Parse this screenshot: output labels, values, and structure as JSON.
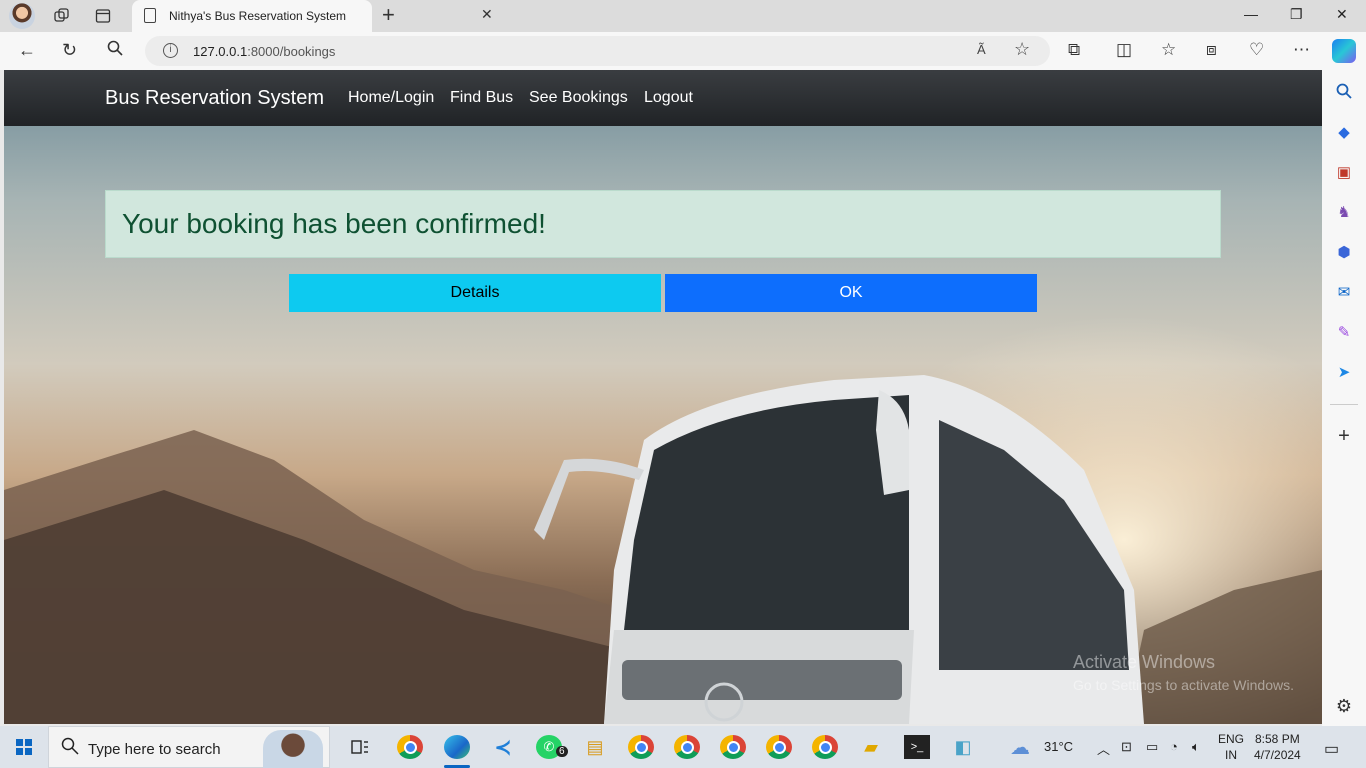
{
  "browser": {
    "tab_title": "Nithya's Bus Reservation System",
    "url_host": "127.0.0.1",
    "url_path": ":8000/bookings",
    "read_aloud": "Ã"
  },
  "page": {
    "brand": "Bus Reservation System",
    "nav_links": [
      "Home/Login",
      "Find Bus",
      "See Bookings",
      "Logout"
    ],
    "alert_message": "Your booking has been confirmed!",
    "details_button": "Details",
    "ok_button": "OK",
    "colors": {
      "alert_bg": "#d1e7dd",
      "alert_text": "#0f5132",
      "details_bg": "#0dcaf0",
      "ok_bg": "#0d6efd",
      "navbar_bg": "#212529"
    }
  },
  "watermark": {
    "line1": "Activate Windows",
    "line2": "Go to Settings to activate Windows."
  },
  "taskbar": {
    "search_placeholder": "Type here to search",
    "whatsapp_badge": "6",
    "weather": "31°C",
    "lang_top": "ENG",
    "lang_bottom": "IN",
    "time": "8:58 PM",
    "date": "4/7/2024"
  }
}
